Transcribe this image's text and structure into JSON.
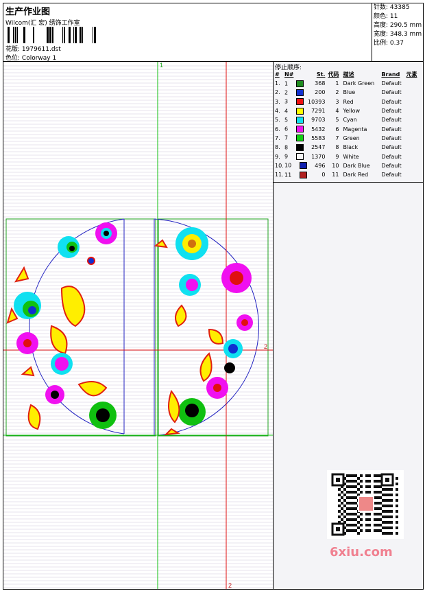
{
  "header": {
    "title": "生产作业图",
    "company": "Wilcom(汇 宏) 绣饰工作室",
    "file_label": "花版:",
    "file_name": "1979611.dst",
    "colorway_label": "色位:",
    "colorway": "Colorway 1"
  },
  "stats": [
    {
      "label": "针数:",
      "value": "43385"
    },
    {
      "label": "颜色:",
      "value": "11"
    },
    {
      "label": "高度:",
      "value": "290.5 mm"
    },
    {
      "label": "宽度:",
      "value": "348.3 mm"
    },
    {
      "label": "比例:",
      "value": "0.37"
    }
  ],
  "guides": {
    "v1": "1",
    "h2": "2",
    "v2": "2"
  },
  "panel": {
    "title": "停止顺序:",
    "headers": [
      "#",
      "N#",
      "St.",
      "代码",
      "描述",
      "Brand",
      "元素"
    ],
    "rows": [
      {
        "idx": "1.",
        "n": "1",
        "st": "368",
        "code": "1",
        "desc": "Dark Green",
        "brand": "Default",
        "color": "#1e8c1e"
      },
      {
        "idx": "2.",
        "n": "2",
        "st": "200",
        "code": "2",
        "desc": "Blue",
        "brand": "Default",
        "color": "#1030d0"
      },
      {
        "idx": "3.",
        "n": "3",
        "st": "10393",
        "code": "3",
        "desc": "Red",
        "brand": "Default",
        "color": "#f01010"
      },
      {
        "idx": "4.",
        "n": "4",
        "st": "7291",
        "code": "4",
        "desc": "Yellow",
        "brand": "Default",
        "color": "#ffff00"
      },
      {
        "idx": "5.",
        "n": "5",
        "st": "9703",
        "code": "5",
        "desc": "Cyan",
        "brand": "Default",
        "color": "#10e0f0"
      },
      {
        "idx": "6.",
        "n": "6",
        "st": "5432",
        "code": "6",
        "desc": "Magenta",
        "brand": "Default",
        "color": "#f010f0"
      },
      {
        "idx": "7.",
        "n": "7",
        "st": "5583",
        "code": "7",
        "desc": "Green",
        "brand": "Default",
        "color": "#10d010"
      },
      {
        "idx": "8.",
        "n": "8",
        "st": "2547",
        "code": "8",
        "desc": "Black",
        "brand": "Default",
        "color": "#000000"
      },
      {
        "idx": "9.",
        "n": "9",
        "st": "1370",
        "code": "9",
        "desc": "White",
        "brand": "Default",
        "color": "#f4f4f4"
      },
      {
        "idx": "10.",
        "n": "10",
        "st": "496",
        "code": "10",
        "desc": "Dark Blue",
        "brand": "Default",
        "color": "#1020b0"
      },
      {
        "idx": "11.",
        "n": "11",
        "st": "0",
        "code": "11",
        "desc": "Dark Red",
        "brand": "Default",
        "color": "#b02020"
      }
    ]
  },
  "watermark": "6xiu.com"
}
